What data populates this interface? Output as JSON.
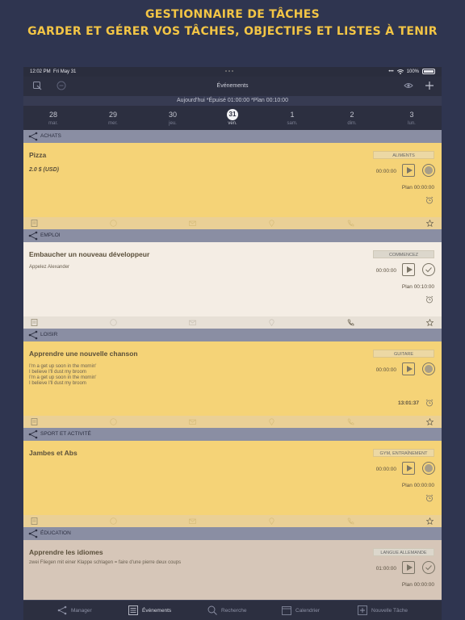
{
  "headline": {
    "line1": "GESTIONNAIRE DE TÂCHES",
    "line2": "GARDER ET GÉRER VOS TÂCHES, OBJECTIFS ET LISTES À TENIR"
  },
  "status": {
    "time": "12:02 PM",
    "date": "Fri May 31",
    "battery": "100%"
  },
  "nav": {
    "title": "Événements"
  },
  "summary": "Aujourd'hui *Épuisé 01:00:00 *Plan 00:10:00",
  "days": [
    {
      "num": "28",
      "wd": "mar."
    },
    {
      "num": "29",
      "wd": "mer."
    },
    {
      "num": "30",
      "wd": "jeu."
    },
    {
      "num": "31",
      "wd": "ven."
    },
    {
      "num": "1",
      "wd": "sam."
    },
    {
      "num": "2",
      "wd": "dim."
    },
    {
      "num": "3",
      "wd": "lun."
    }
  ],
  "sections": [
    {
      "label": "ACHATS",
      "title": "Pizza",
      "price": "2.0 $ (USD)",
      "tag": "ALIMENTS",
      "timer": "00:00:00",
      "plan": "Plan 00:00:00"
    },
    {
      "label": "EMPLOI",
      "title": "Embaucher un nouveau développeur",
      "sub": "Appelez Alexander",
      "tag": "COMMENCEZ",
      "timer": "00:00:00",
      "plan": "Plan 00:10:00"
    },
    {
      "label": "LOISIR",
      "title": "Apprendre une nouvelle chanson",
      "sub": [
        "I'm a get up soon in the mornin'",
        "I believe I'll dust my broom",
        "I'm a get up soon in the mornin'",
        "I believe I'll dust my broom"
      ],
      "tag": "GUITARE",
      "timer": "00:00:00",
      "plan": "13:01:37"
    },
    {
      "label": "SPORT ET ACTIVITÉ",
      "title": "Jambes et Abs",
      "tag": "GYM, ENTRAÎNEMENT",
      "timer": "00:00:00",
      "plan": "Plan 00:00:00"
    },
    {
      "label": "ÉDUCATION",
      "title": "Apprendre les idiomes",
      "sub": "zwei Fliegen mit einer Klappe schlagen = faire d'une pierre deux coups",
      "tag": "LANGUE ALLEMANDE",
      "timer": "01:00:00",
      "plan": "Plan 00:00:00"
    }
  ],
  "tabs": [
    "Manager",
    "Événements",
    "Recherche",
    "Calendrier",
    "Nouvelle Tâche"
  ],
  "colors": {
    "accent": "#f3c545",
    "card_yellow": "#f5d377",
    "card_cream": "#f4ede4",
    "card_beige": "#d6c6b8",
    "section": "#8a8ea3"
  }
}
